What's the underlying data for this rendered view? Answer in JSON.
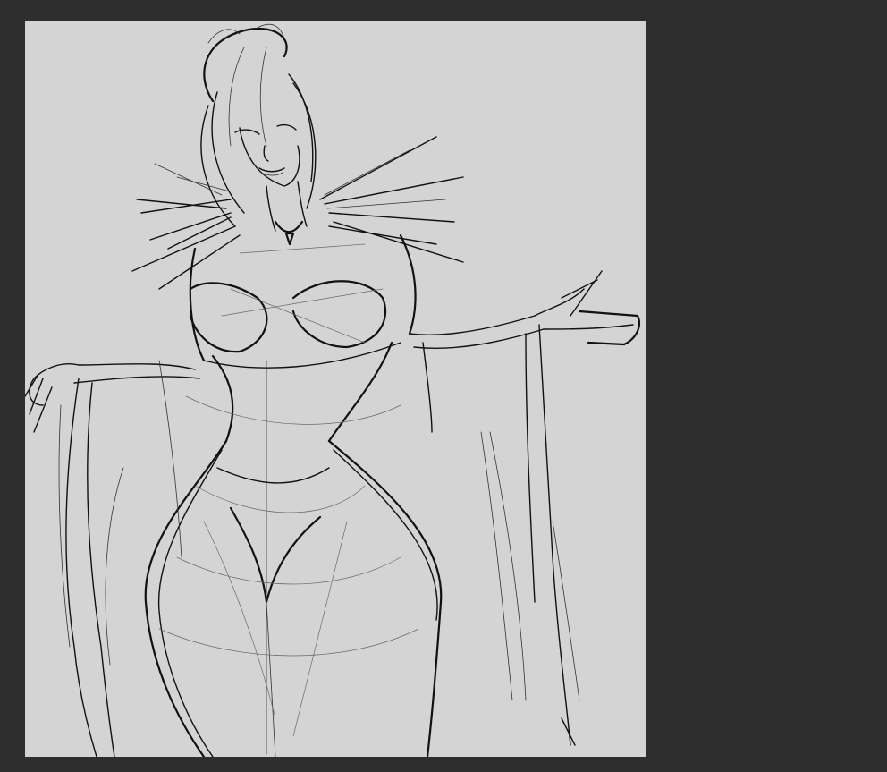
{
  "app": {
    "workspace_background": "#2e2e2e",
    "canvas_background": "#d4d4d4",
    "ink_color": "#111111"
  },
  "canvas": {
    "content": "sketch-artwork"
  }
}
